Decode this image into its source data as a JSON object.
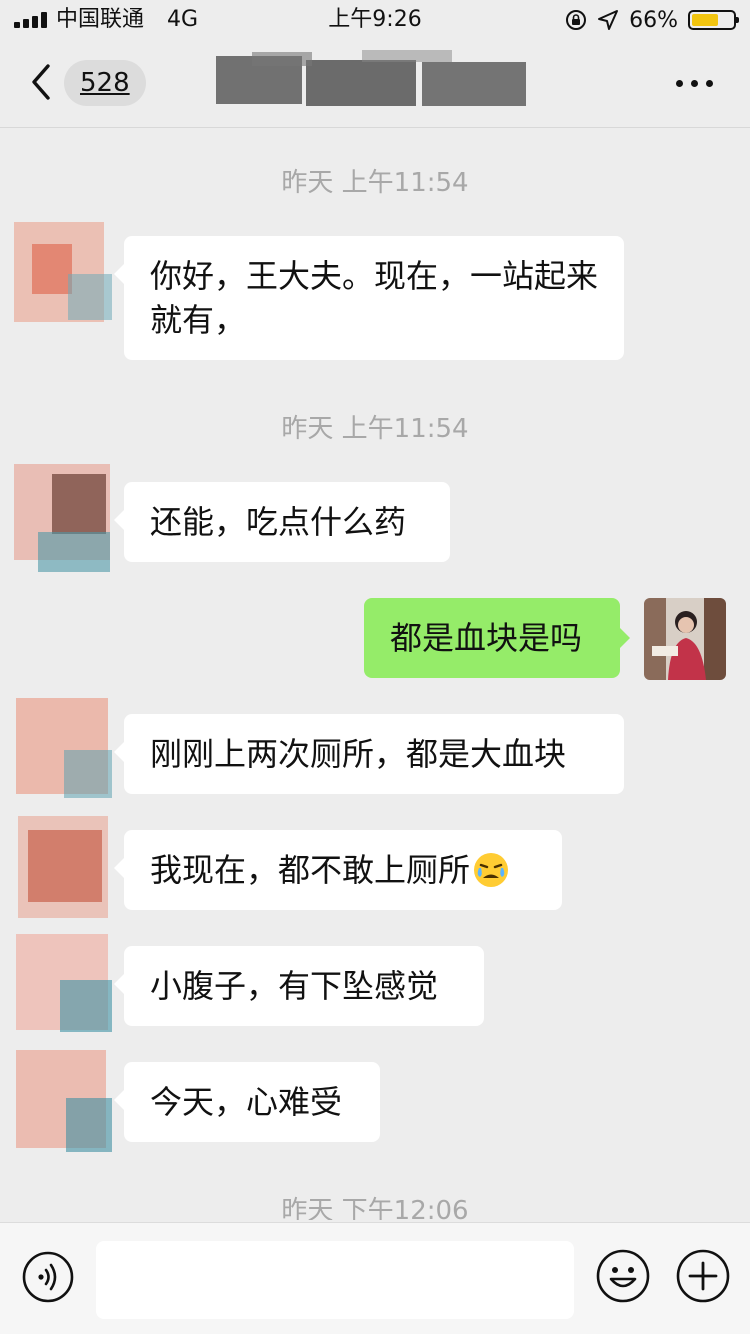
{
  "status_bar": {
    "carrier": "中国联通",
    "network": "4G",
    "time": "上午9:26",
    "battery_percent": "66%",
    "battery_level": 0.66,
    "battery_color": "#f1c40f"
  },
  "nav": {
    "unread_count": "528",
    "back_icon": "chevron-left-icon",
    "more_icon": "more-horizontal-icon"
  },
  "chat": {
    "timestamps": [
      "昨天 上午11:54",
      "昨天 上午11:54",
      "昨天 下午12:06"
    ],
    "messages": [
      {
        "side": "left",
        "text": "你好，王大夫。现在，一站起来就有，"
      },
      {
        "side": "left",
        "text": "还能，吃点什么药"
      },
      {
        "side": "right",
        "text": "都是血块是吗"
      },
      {
        "side": "left",
        "text": "刚刚上两次厕所，都是大血块"
      },
      {
        "side": "left",
        "text": "我现在，都不敢上厕所",
        "emoji": "crying-face-icon"
      },
      {
        "side": "left",
        "text": "小腹子，有下坠感觉"
      },
      {
        "side": "left",
        "text": "今天，心难受"
      }
    ],
    "colors": {
      "incoming_bubble": "#ffffff",
      "outgoing_bubble": "#95ec69",
      "background": "#ededed",
      "timestamp_text": "#a8a8a8"
    }
  },
  "input_bar": {
    "message_value": "",
    "voice_icon": "voice-icon",
    "emoji_icon": "smiley-icon",
    "add_icon": "plus-circle-icon"
  }
}
